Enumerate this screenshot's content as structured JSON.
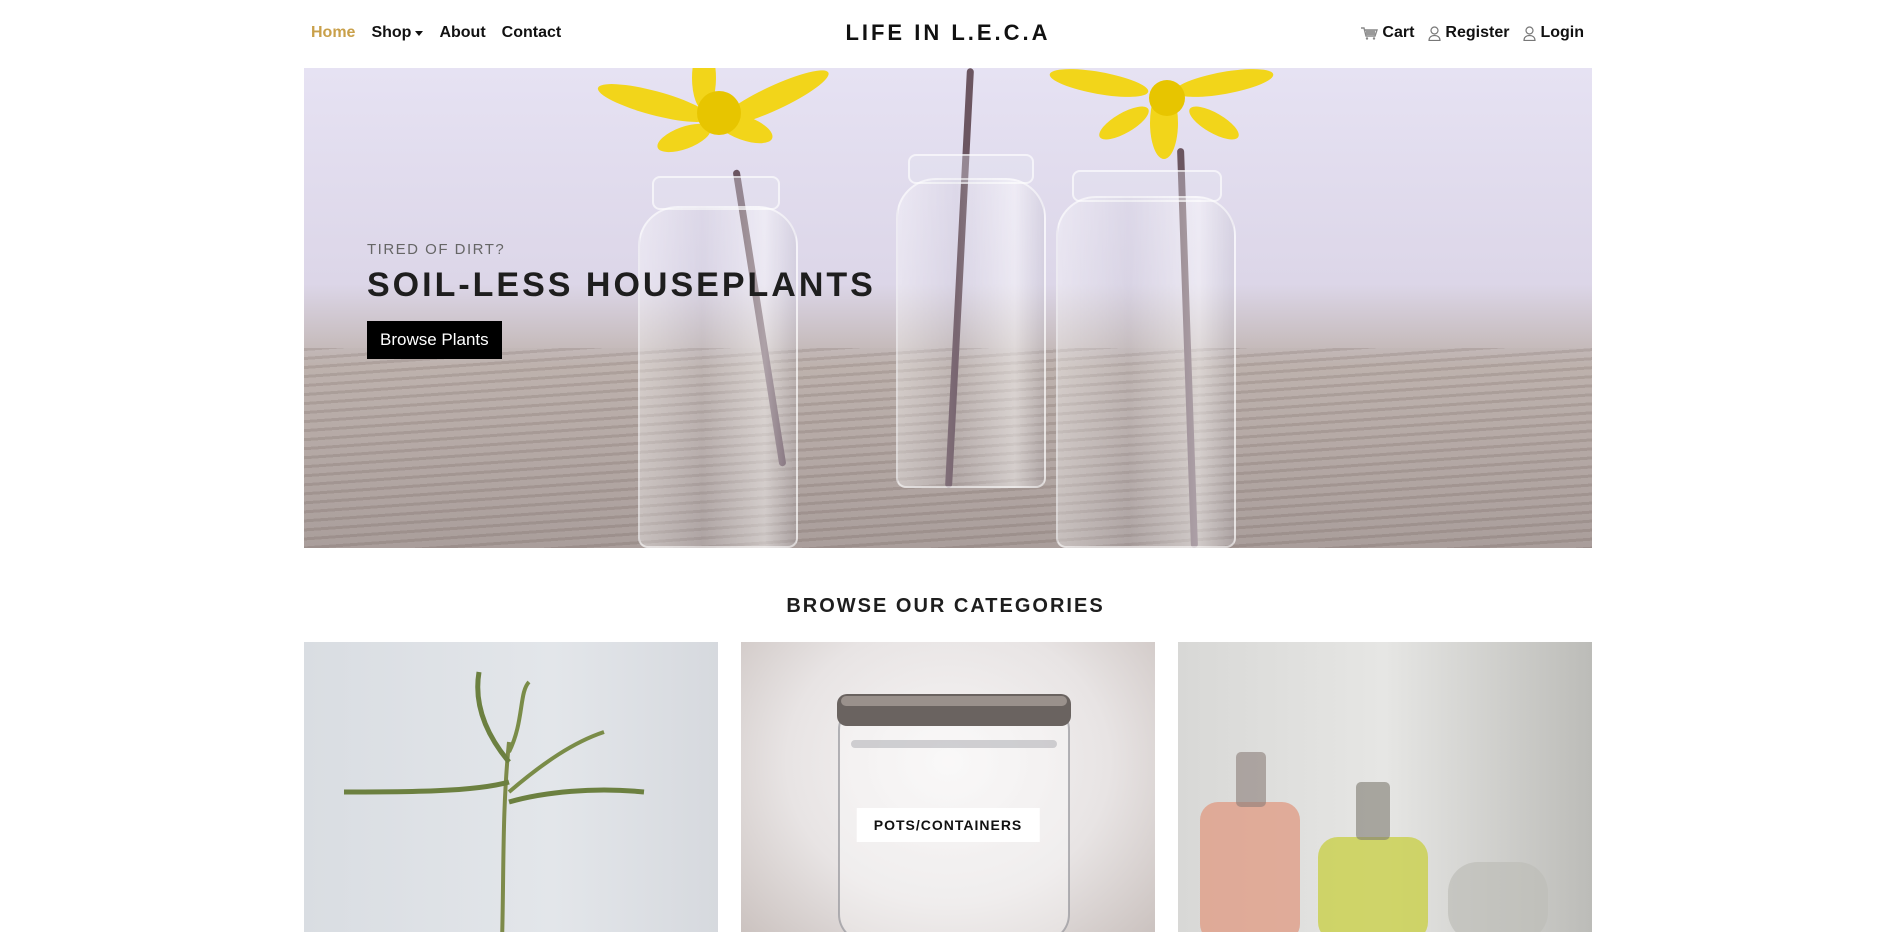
{
  "nav": {
    "left": [
      {
        "label": "Home",
        "active": true
      },
      {
        "label": "Shop",
        "dropdown": true
      },
      {
        "label": "About"
      },
      {
        "label": "Contact"
      }
    ],
    "brand": "LIFE IN L.E.C.A",
    "right": [
      {
        "label": "Cart",
        "icon": "cart-icon"
      },
      {
        "label": "Register",
        "icon": "user-icon"
      },
      {
        "label": "Login",
        "icon": "user-icon"
      }
    ],
    "active_color": "#c9a04a"
  },
  "hero": {
    "subtitle": "TIRED OF DIRT?",
    "title": "SOIL-LESS HOUSEPLANTS",
    "button_label": "Browse Plants"
  },
  "categories": {
    "title": "BROWSE OUR CATEGORIES",
    "items": [
      {
        "label": "",
        "image": "plant-stem-photo"
      },
      {
        "label": "POTS/CONTAINERS",
        "image": "glass-jar-photo"
      },
      {
        "label": "",
        "image": "bottles-photo"
      }
    ]
  }
}
